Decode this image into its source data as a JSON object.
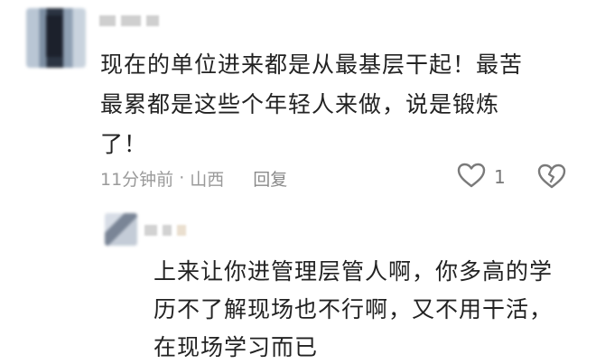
{
  "comment": {
    "lines": [
      "现在的单位进来都是从最基层干起！最苦",
      "最累都是这些个年轻人来做，说是锻炼",
      "了！"
    ],
    "time": "11分钟前",
    "separator": "·",
    "location": "山西",
    "reply_label": "回复",
    "like_count": "1",
    "like_icon": "heart-outline-icon",
    "dislike_icon": "broken-heart-icon"
  },
  "reply": {
    "lines": [
      "上来让你进管理层管人啊，你多高的学",
      "历不了解现场也不行啊，又不用干活，",
      "在现场学习而已"
    ]
  }
}
